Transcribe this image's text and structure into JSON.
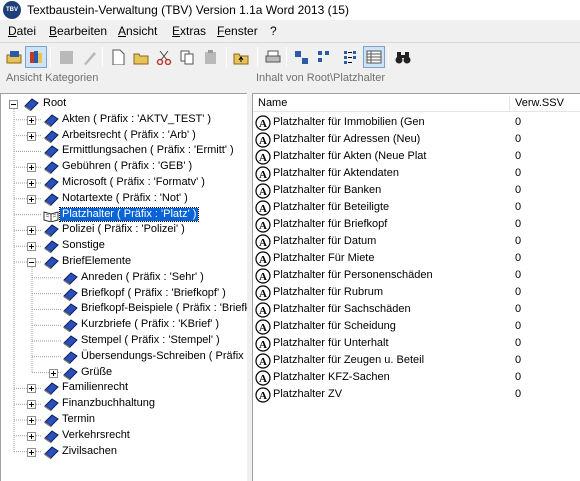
{
  "window": {
    "title": "Textbaustein-Verwaltung (TBV) Version 1.1a Word 2013 (15)",
    "icon_text": "TBV"
  },
  "menu": [
    {
      "label": "Datei",
      "key": "datei"
    },
    {
      "label": "Bearbeiten",
      "key": "bearbeiten"
    },
    {
      "label": "Ansicht",
      "key": "ansicht"
    },
    {
      "label": "Extras",
      "key": "extras"
    },
    {
      "label": "Fenster",
      "key": "fenster"
    },
    {
      "label": "?",
      "key": "help"
    }
  ],
  "toolbar": [
    {
      "icon": "folder-open-book-icon",
      "enabled": true
    },
    {
      "icon": "books-icon",
      "enabled": true,
      "active": true
    },
    {
      "icon": "disabled-square-icon",
      "enabled": false
    },
    {
      "icon": "disabled-pen-icon",
      "enabled": false
    },
    {
      "icon": "new-document-icon",
      "enabled": true
    },
    {
      "icon": "open-folder-icon",
      "enabled": true
    },
    {
      "icon": "cut-icon",
      "enabled": true
    },
    {
      "icon": "copy-icon",
      "enabled": true
    },
    {
      "icon": "disabled-paste-icon",
      "enabled": false
    },
    {
      "icon": "up-level-icon",
      "enabled": true
    },
    {
      "icon": "print-icon",
      "enabled": true
    },
    {
      "icon": "large-icons-view-icon",
      "enabled": true
    },
    {
      "icon": "small-icons-view-icon",
      "enabled": true
    },
    {
      "icon": "list-view-icon",
      "enabled": true
    },
    {
      "icon": "details-view-icon",
      "enabled": true,
      "active": true
    },
    {
      "icon": "binoculars-icon",
      "enabled": true
    }
  ],
  "left_pane": {
    "header": "Ansicht Kategorien"
  },
  "right_pane": {
    "header": "Inhalt von Root\\Platzhalter"
  },
  "tree": [
    {
      "label": "Root",
      "depth": 0,
      "expander": "minus"
    },
    {
      "label": "Akten ( Präfix : 'AKTV_TEST' )",
      "depth": 1,
      "expander": "plus"
    },
    {
      "label": "Arbeitsrecht ( Präfix : 'Arb' )",
      "depth": 1,
      "expander": "plus"
    },
    {
      "label": "Ermittlungsachen ( Präfix : 'Ermitt' )",
      "depth": 1,
      "expander": "none"
    },
    {
      "label": "Gebühren ( Präfix : 'GEB' )",
      "depth": 1,
      "expander": "plus"
    },
    {
      "label": "Microsoft ( Präfix : 'Formatv' )",
      "depth": 1,
      "expander": "plus"
    },
    {
      "label": "Notartexte ( Präfix : 'Not' )",
      "depth": 1,
      "expander": "plus"
    },
    {
      "label": "Platzhalter ( Präfix : 'Platz' )",
      "depth": 1,
      "expander": "none",
      "selected": true,
      "open": true
    },
    {
      "label": "Polizei ( Präfix : 'Polizei' )",
      "depth": 1,
      "expander": "plus"
    },
    {
      "label": "Sonstige",
      "depth": 1,
      "expander": "plus"
    },
    {
      "label": "BriefElemente",
      "depth": 1,
      "expander": "minus"
    },
    {
      "label": "Anreden ( Präfix : 'Sehr' )",
      "depth": 2,
      "expander": "none"
    },
    {
      "label": "Briefkopf ( Präfix : 'Briefkopf' )",
      "depth": 2,
      "expander": "none"
    },
    {
      "label": "Briefkopf-Beispiele ( Präfix : 'Briefk",
      "depth": 2,
      "expander": "none"
    },
    {
      "label": "Kurzbriefe ( Präfix : 'KBrief' )",
      "depth": 2,
      "expander": "none"
    },
    {
      "label": "Stempel ( Präfix : 'Stempel' )",
      "depth": 2,
      "expander": "none"
    },
    {
      "label": "Übersendungs-Schreiben ( Präfix :",
      "depth": 2,
      "expander": "none"
    },
    {
      "label": "Grüße",
      "depth": 2,
      "expander": "plus"
    },
    {
      "label": "Familienrecht",
      "depth": 1,
      "expander": "plus"
    },
    {
      "label": "Finanzbuchhaltung",
      "depth": 1,
      "expander": "plus"
    },
    {
      "label": "Termin",
      "depth": 1,
      "expander": "plus"
    },
    {
      "label": "Verkehrsrecht",
      "depth": 1,
      "expander": "plus"
    },
    {
      "label": "Zivilsachen",
      "depth": 1,
      "expander": "plus"
    }
  ],
  "list": {
    "columns": [
      "Name",
      "Verw.SSV"
    ],
    "rows": [
      {
        "name": "Platzhalter für  Immobilien (Gen",
        "value": "0"
      },
      {
        "name": "Platzhalter für Adressen (Neu)",
        "value": "0"
      },
      {
        "name": "Platzhalter für Akten (Neue Plat",
        "value": "0"
      },
      {
        "name": "Platzhalter für Aktendaten",
        "value": "0"
      },
      {
        "name": "Platzhalter für Banken",
        "value": "0"
      },
      {
        "name": "Platzhalter für Beteiligte",
        "value": "0"
      },
      {
        "name": "Platzhalter für Briefkopf",
        "value": "0"
      },
      {
        "name": "Platzhalter für Datum",
        "value": "0"
      },
      {
        "name": "Platzhalter Für Miete",
        "value": "0"
      },
      {
        "name": "Platzhalter für Personenschäden",
        "value": "0"
      },
      {
        "name": "Platzhalter für Rubrum",
        "value": "0"
      },
      {
        "name": "Platzhalter für Sachschäden",
        "value": "0"
      },
      {
        "name": "Platzhalter für Scheidung",
        "value": "0"
      },
      {
        "name": "Platzhalter für Unterhalt",
        "value": "0"
      },
      {
        "name": "Platzhalter für Zeugen u. Beteil",
        "value": "0"
      },
      {
        "name": "Platzhalter KFZ-Sachen",
        "value": "0"
      },
      {
        "name": "Platzhalter ZV",
        "value": "0"
      }
    ]
  }
}
